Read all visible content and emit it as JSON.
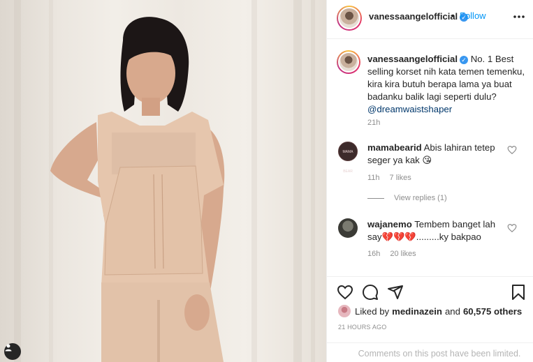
{
  "header": {
    "username": "vanessaangelofficial",
    "separator": "•",
    "follow_label": "Follow",
    "more_label": "•••"
  },
  "caption": {
    "username": "vanessaangelofficial",
    "text": "No. 1 Best selling korset nih kata temen temenku, kira kira butuh berapa lama ya buat badanku balik lagi seperti dulu?",
    "mention": "@dreamwaistshaper",
    "time": "21h"
  },
  "comments": [
    {
      "username": "mamabearid",
      "text": "Abis lahiran tetep seger ya kak 😘",
      "time": "11h",
      "likes": "7 likes",
      "view_replies": "View replies (1)",
      "avatar_text": "MAMA BEAR"
    },
    {
      "username": "wajanemo",
      "text": "Tembem banget lah say💔💔💔.........ky bakpao",
      "time": "16h",
      "likes": "20 likes"
    }
  ],
  "actions": {
    "icons": [
      "heart-icon",
      "comment-icon",
      "share-icon",
      "bookmark-icon"
    ],
    "liked_by_prefix": "Liked by",
    "liked_by_user": "medinazein",
    "liked_by_and": "and",
    "liked_by_count": "60,575 others",
    "timestamp": "21 HOURS AGO",
    "comments_limited": "Comments on this post have been limited."
  },
  "colors": {
    "link_blue": "#0095f6",
    "verified_blue": "#3897f0",
    "muted_gray": "#8e8e8e",
    "border": "#efefef"
  }
}
